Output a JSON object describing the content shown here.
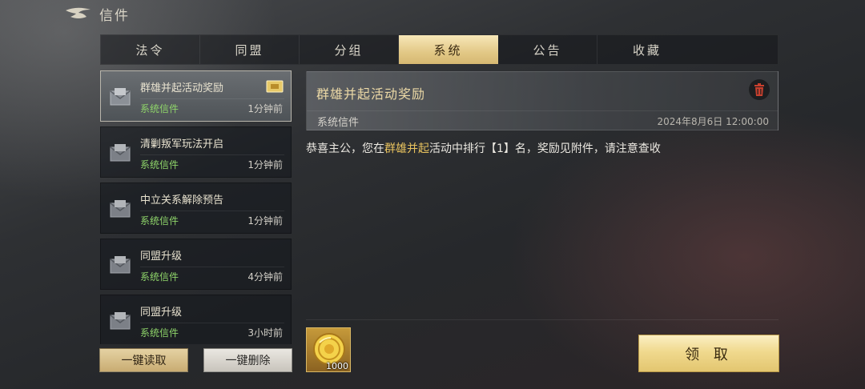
{
  "header": {
    "title": "信件"
  },
  "tabs": [
    {
      "label": "法令",
      "active": false
    },
    {
      "label": "同盟",
      "active": false
    },
    {
      "label": "分组",
      "active": false
    },
    {
      "label": "系统",
      "active": true
    },
    {
      "label": "公告",
      "active": false
    },
    {
      "label": "收藏",
      "active": false
    }
  ],
  "mail_list": [
    {
      "subject": "群雄并起活动奖励",
      "sender": "系统信件",
      "time": "1分钟前",
      "selected": true,
      "has_attachment": true
    },
    {
      "subject": "清剿叛军玩法开启",
      "sender": "系统信件",
      "time": "1分钟前",
      "selected": false,
      "has_attachment": false
    },
    {
      "subject": "中立关系解除预告",
      "sender": "系统信件",
      "time": "1分钟前",
      "selected": false,
      "has_attachment": false
    },
    {
      "subject": "同盟升级",
      "sender": "系统信件",
      "time": "4分钟前",
      "selected": false,
      "has_attachment": false
    },
    {
      "subject": "同盟升级",
      "sender": "系统信件",
      "time": "3小时前",
      "selected": false,
      "has_attachment": false
    }
  ],
  "actions": {
    "read_all": "一键读取",
    "delete_all": "一键删除"
  },
  "detail": {
    "title": "群雄并起活动奖励",
    "sender": "系统信件",
    "date": "2024年8月6日 12:00:00",
    "body_prefix": "恭喜主公，您在",
    "body_highlight": "群雄并起",
    "body_suffix": "活动中排行【1】名，奖励见附件，请注意查收",
    "reward": {
      "icon": "gold-coin-icon",
      "quantity": "1000"
    },
    "claim_label": "领 取"
  },
  "colors": {
    "accent_gold": "#e9c35e",
    "sender_green": "#8fd56a",
    "tab_active": "#e2c886"
  }
}
